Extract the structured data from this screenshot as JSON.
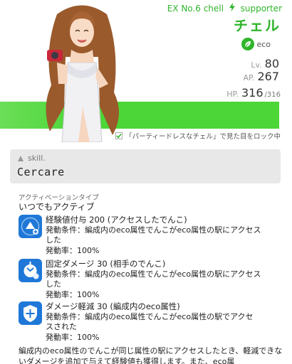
{
  "header": {
    "ex_line": "EX No.6 chell",
    "type": "supporter",
    "name": "チェル",
    "attribute": "eco",
    "stats": {
      "lv_label": "Lv.",
      "lv_value": "80",
      "ap_label": "AP.",
      "ap_value": "267",
      "hp_label": "HP.",
      "hp_value": "316",
      "hp_max": "/316"
    },
    "lock_note": "「パーティードレスなチェル」で見た目をロック中"
  },
  "skill": {
    "tag": "skill.",
    "name": "Cercare"
  },
  "activation": {
    "label": "アクティベーションタイプ",
    "value": "いつでもアクティブ"
  },
  "effects": [
    {
      "title": "経験値付与 200 (アクセスしたでんこ)",
      "condition": "発動条件：編成内のeco属性でんこがeco属性の駅にアクセス",
      "condition2": "した",
      "rate": "発動率：100%",
      "icon": "exp-gain-icon"
    },
    {
      "title": "固定ダメージ 30 (相手のでんこ)",
      "condition": "発動条件：編成内のeco属性でんこがeco属性の駅にアクセス",
      "condition2": "した",
      "rate": "発動率：100%",
      "icon": "fixed-damage-icon"
    },
    {
      "title": "ダメージ軽減 30 (編成内のeco属性)",
      "condition": "発動条件：編成内のeco属性でんこがeco属性の駅でアクセ",
      "condition2": "スされた",
      "rate": "発動率：100%",
      "icon": "damage-reduce-icon"
    }
  ],
  "description": "編成内のeco属性のでんこが同じ属性の駅にアクセスしたとき、軽減できないダメージを追加で与えて経験値も獲得します。また、eco属",
  "colors": {
    "accent": "#2fb52a",
    "band": "#4cd637",
    "icon_bg": "#1f78d8"
  }
}
